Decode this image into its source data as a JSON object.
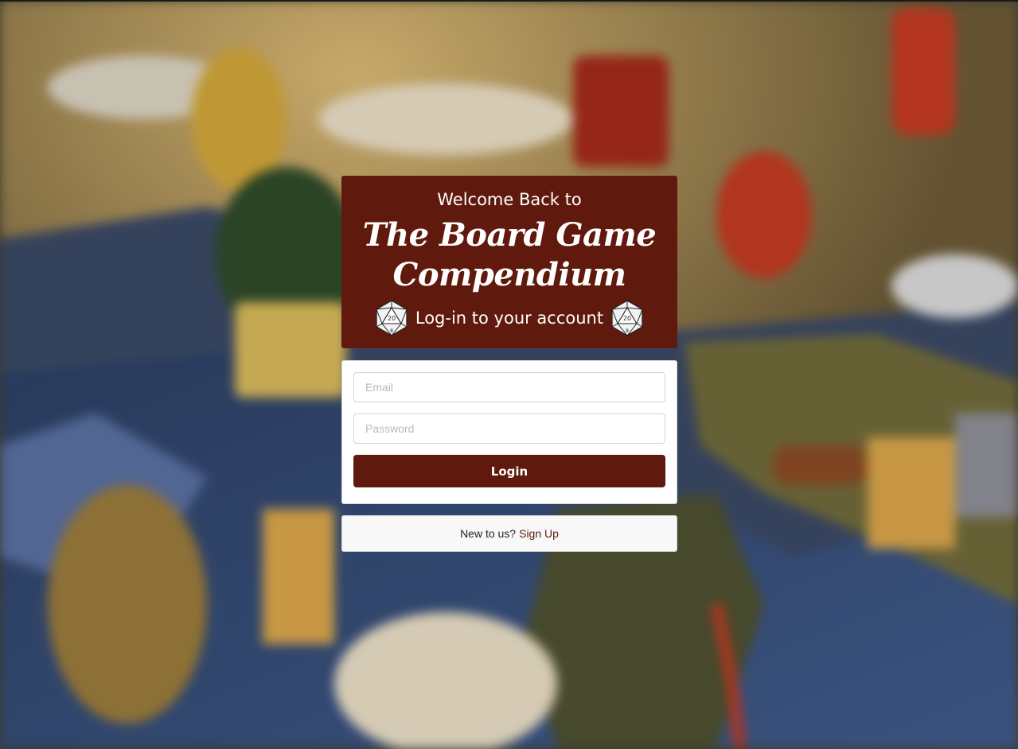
{
  "header": {
    "welcome": "Welcome Back to",
    "brand": "The Board Game Compendium",
    "subtitle": "Log-in to your account",
    "left_icon": "d20-die-icon",
    "right_icon": "d20-die-icon"
  },
  "form": {
    "email_placeholder": "Email",
    "password_placeholder": "Password",
    "login_label": "Login"
  },
  "signup": {
    "prompt": "New to us?",
    "link_label": "Sign Up"
  },
  "colors": {
    "brand_maroon": "#601a0d",
    "panel_white": "#ffffff",
    "signup_bg": "#f8f8f9"
  },
  "background": "blurred board game map photo"
}
